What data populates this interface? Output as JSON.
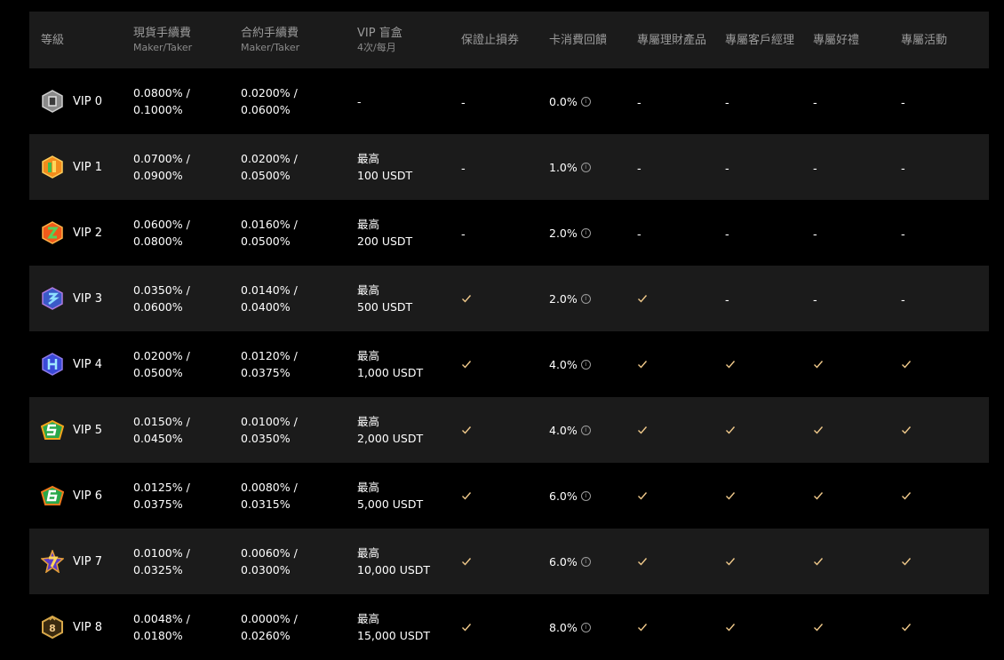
{
  "header": {
    "level": "等級",
    "spot_fee": "現貨手續費",
    "spot_fee_sub": "Maker/Taker",
    "futures_fee": "合約手續費",
    "futures_fee_sub": "Maker/Taker",
    "blind_box": "VIP 盲盒",
    "blind_box_sub": "4次/每月",
    "stop_loss": "保證止損券",
    "card_rebate": "卡消費回饋",
    "wealth": "專屬理財產品",
    "manager": "專屬客戶經理",
    "gift": "專屬好禮",
    "event": "專屬活動"
  },
  "colors": {
    "check": "#f0c98a",
    "row_alt": "#1b1b1b",
    "header_text": "#9a9a9a"
  },
  "rows": [
    {
      "vip": "VIP 0",
      "badge": "vip0-badge-icon",
      "spot_maker": "0.0800% /",
      "spot_taker": "0.1000%",
      "fut_maker": "0.0200% /",
      "fut_taker": "0.0600%",
      "box_top": "-",
      "box_bottom": "",
      "stop_loss": "-",
      "rebate": "0.0%",
      "wealth": "-",
      "manager": "-",
      "gift": "-",
      "event": "-"
    },
    {
      "vip": "VIP 1",
      "badge": "vip1-badge-icon",
      "spot_maker": "0.0700% /",
      "spot_taker": "0.0900%",
      "fut_maker": "0.0200% /",
      "fut_taker": "0.0500%",
      "box_top": "最高",
      "box_bottom": "100 USDT",
      "stop_loss": "-",
      "rebate": "1.0%",
      "wealth": "-",
      "manager": "-",
      "gift": "-",
      "event": "-"
    },
    {
      "vip": "VIP 2",
      "badge": "vip2-badge-icon",
      "spot_maker": "0.0600% /",
      "spot_taker": "0.0800%",
      "fut_maker": "0.0160% /",
      "fut_taker": "0.0500%",
      "box_top": "最高",
      "box_bottom": "200 USDT",
      "stop_loss": "-",
      "rebate": "2.0%",
      "wealth": "-",
      "manager": "-",
      "gift": "-",
      "event": "-"
    },
    {
      "vip": "VIP 3",
      "badge": "vip3-badge-icon",
      "spot_maker": "0.0350% /",
      "spot_taker": "0.0600%",
      "fut_maker": "0.0140% /",
      "fut_taker": "0.0400%",
      "box_top": "最高",
      "box_bottom": "500 USDT",
      "stop_loss": "check",
      "rebate": "2.0%",
      "wealth": "check",
      "manager": "-",
      "gift": "-",
      "event": "-"
    },
    {
      "vip": "VIP 4",
      "badge": "vip4-badge-icon",
      "spot_maker": "0.0200% /",
      "spot_taker": "0.0500%",
      "fut_maker": "0.0120% /",
      "fut_taker": "0.0375%",
      "box_top": "最高",
      "box_bottom": "1,000 USDT",
      "stop_loss": "check",
      "rebate": "4.0%",
      "wealth": "check",
      "manager": "check",
      "gift": "check",
      "event": "check"
    },
    {
      "vip": "VIP 5",
      "badge": "vip5-badge-icon",
      "spot_maker": "0.0150% /",
      "spot_taker": "0.0450%",
      "fut_maker": "0.0100% /",
      "fut_taker": "0.0350%",
      "box_top": "最高",
      "box_bottom": "2,000 USDT",
      "stop_loss": "check",
      "rebate": "4.0%",
      "wealth": "check",
      "manager": "check",
      "gift": "check",
      "event": "check"
    },
    {
      "vip": "VIP 6",
      "badge": "vip6-badge-icon",
      "spot_maker": "0.0125% /",
      "spot_taker": "0.0375%",
      "fut_maker": "0.0080% /",
      "fut_taker": "0.0315%",
      "box_top": "最高",
      "box_bottom": "5,000 USDT",
      "stop_loss": "check",
      "rebate": "6.0%",
      "wealth": "check",
      "manager": "check",
      "gift": "check",
      "event": "check"
    },
    {
      "vip": "VIP 7",
      "badge": "vip7-badge-icon",
      "spot_maker": "0.0100% /",
      "spot_taker": "0.0325%",
      "fut_maker": "0.0060% /",
      "fut_taker": "0.0300%",
      "box_top": "最高",
      "box_bottom": "10,000 USDT",
      "stop_loss": "check",
      "rebate": "6.0%",
      "wealth": "check",
      "manager": "check",
      "gift": "check",
      "event": "check"
    },
    {
      "vip": "VIP 8",
      "badge": "vip8-badge-icon",
      "spot_maker": "0.0048% /",
      "spot_taker": "0.0180%",
      "fut_maker": "0.0000% /",
      "fut_taker": "0.0260%",
      "box_top": "最高",
      "box_bottom": "15,000 USDT",
      "stop_loss": "check",
      "rebate": "8.0%",
      "wealth": "check",
      "manager": "check",
      "gift": "check",
      "event": "check"
    }
  ]
}
